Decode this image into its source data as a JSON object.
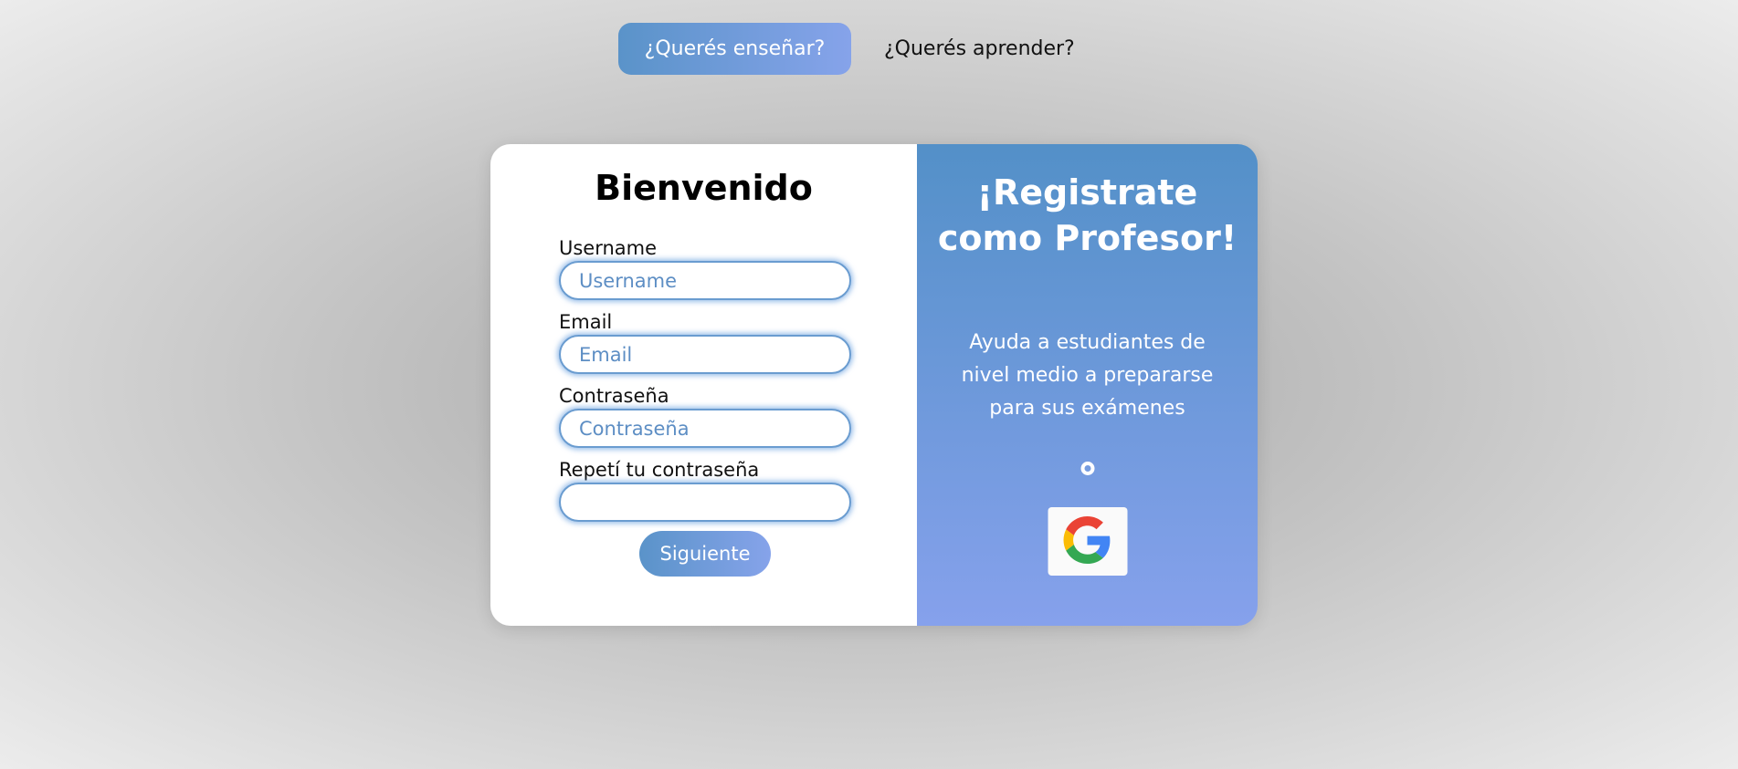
{
  "tabs": {
    "teach_label": "¿Querés enseñar?",
    "learn_label": "¿Querés aprender?"
  },
  "form": {
    "title": "Bienvenido",
    "username_label": "Username",
    "username_placeholder": "Username",
    "email_label": "Email",
    "email_placeholder": "Email",
    "password_label": "Contraseña",
    "password_placeholder": "Contraseña",
    "repeat_label": "Repetí tu contraseña",
    "repeat_placeholder": "",
    "submit_label": "Siguiente"
  },
  "promo": {
    "title": "¡Registrate como Profesor!",
    "description": "Ayuda a estudiantes de nivel medio a prepararse para sus exámenes",
    "google_icon": "google-icon"
  },
  "colors": {
    "accent_start": "#5a93c9",
    "accent_end": "#86a3ea"
  }
}
